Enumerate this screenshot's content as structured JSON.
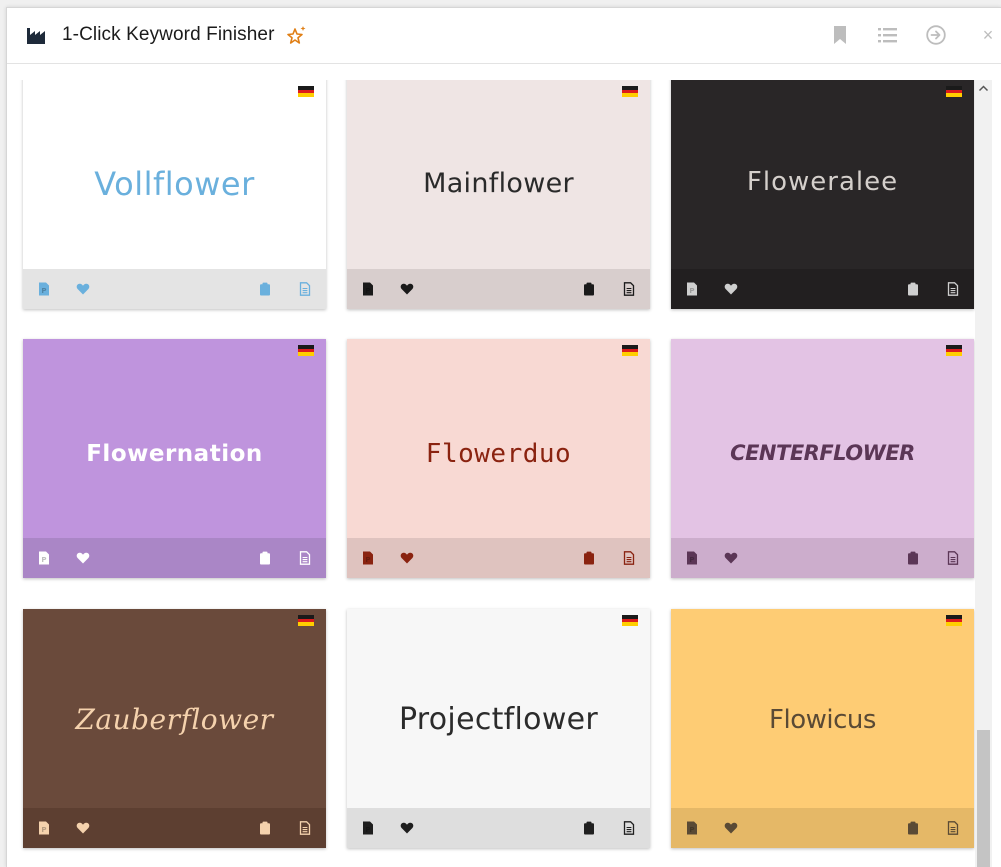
{
  "app": {
    "title": "1-Click Keyword Finisher"
  },
  "header_icons": [
    "factory-logo-icon",
    "sparkle-star-icon",
    "bookmark-icon",
    "list-icon",
    "arrow-right-circle-icon",
    "close-icon"
  ],
  "header": {
    "close_glyph": "×"
  },
  "cards": [
    {
      "name": "Vollflower",
      "bg": "#ffffff",
      "footer_bg": "#e4e4e4",
      "color": "#6ab0dd",
      "icon_color": "#6ab0dd"
    },
    {
      "name": "Mainflower",
      "bg": "#efe5e4",
      "footer_bg": "#d8cecd",
      "color": "#2a2a2a",
      "icon_color": "#1a1a1a"
    },
    {
      "name": "Floweralee",
      "bg": "#292627",
      "footer_bg": "#221f20",
      "color": "#d4cfcb",
      "icon_color": "#cfcfcf"
    },
    {
      "name": "Flowernation",
      "bg": "#bf94dd",
      "footer_bg": "#aa86c6",
      "color": "#ffffff",
      "icon_color": "#ffffff"
    },
    {
      "name": "Flowerduo",
      "bg": "#f8d9d3",
      "footer_bg": "#dfc3bf",
      "color": "#8a2310",
      "icon_color": "#8a2310"
    },
    {
      "name": "CENTERFLOWER",
      "bg": "#e3c3e4",
      "footer_bg": "#ccadcc",
      "color": "#5b3656",
      "icon_color": "#5b3656"
    },
    {
      "name": "Zauberflower",
      "bg": "#6a4a3b",
      "footer_bg": "#5d3f31",
      "color": "#f5d2ad",
      "icon_color": "#f5d2ad"
    },
    {
      "name": "Projectflower",
      "bg": "#f7f7f7",
      "footer_bg": "#dedede",
      "color": "#2b2b2b",
      "icon_color": "#1f1f1f"
    },
    {
      "name": "Flowicus",
      "bg": "#fecc74",
      "footer_bg": "#e5b867",
      "color": "#5a4a35",
      "icon_color": "#5a4a35"
    }
  ],
  "card_icons": [
    "flag-germany-icon",
    "p-document-icon",
    "heart-icon",
    "clipboard-icon",
    "document-icon"
  ]
}
